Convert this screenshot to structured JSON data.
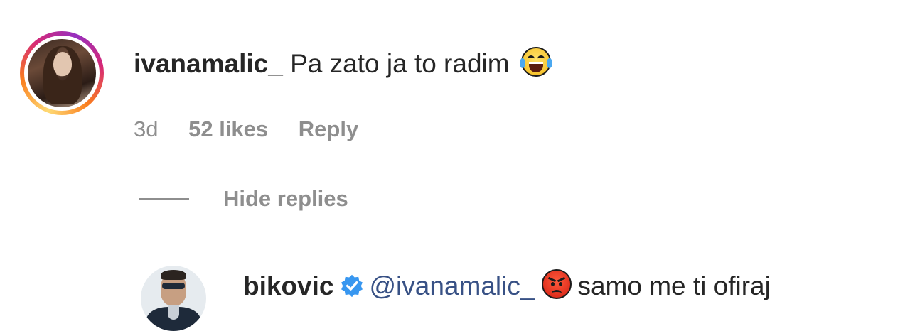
{
  "comment": {
    "username": "ivanamalic_",
    "text": "Pa zato ja to radim",
    "emoji": "face-with-tears-of-joy",
    "avatar": "user-avatar",
    "story_ring": true,
    "time": "3d",
    "likes": "52 likes",
    "reply_label": "Reply"
  },
  "replies_toggle": {
    "label": "Hide replies"
  },
  "reply": {
    "username": "bikovic",
    "verified": true,
    "verified_icon": "verified-badge-icon",
    "mention": "@ivanamalic_",
    "emoji": "angry-face",
    "text": "samo me ti ofiraj",
    "avatar": "user-avatar"
  },
  "colors": {
    "text": "#262626",
    "meta": "#8e8e8e",
    "mention": "#385185",
    "verified": "#3897f0"
  }
}
